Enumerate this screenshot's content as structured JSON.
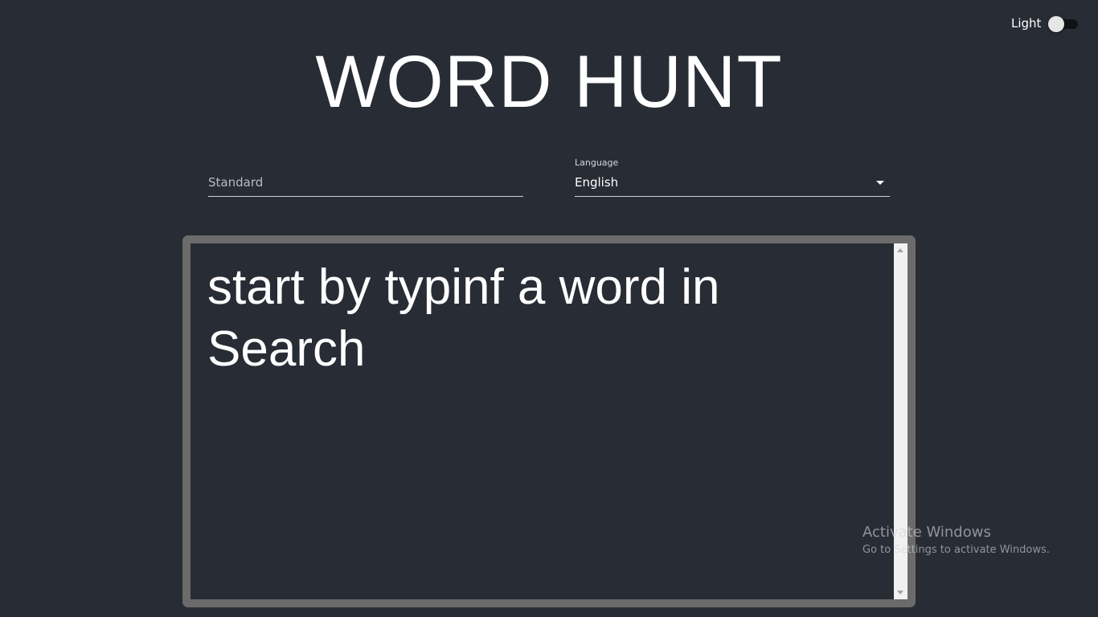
{
  "theme_toggle": {
    "label": "Light",
    "checked": false
  },
  "header": {
    "title": "WORD HUNT"
  },
  "search": {
    "placeholder": "Standard",
    "value": ""
  },
  "language": {
    "label": "Language",
    "selected": "English"
  },
  "results": {
    "message": "start by typinf a word in Search"
  },
  "watermark": {
    "title": "Activate Windows",
    "subtitle": "Go to Settings to activate Windows."
  },
  "colors": {
    "background": "#282c35",
    "text": "#ffffff",
    "panel_border": "#6b6b6b",
    "scrollbar": "#f1f1f1"
  }
}
